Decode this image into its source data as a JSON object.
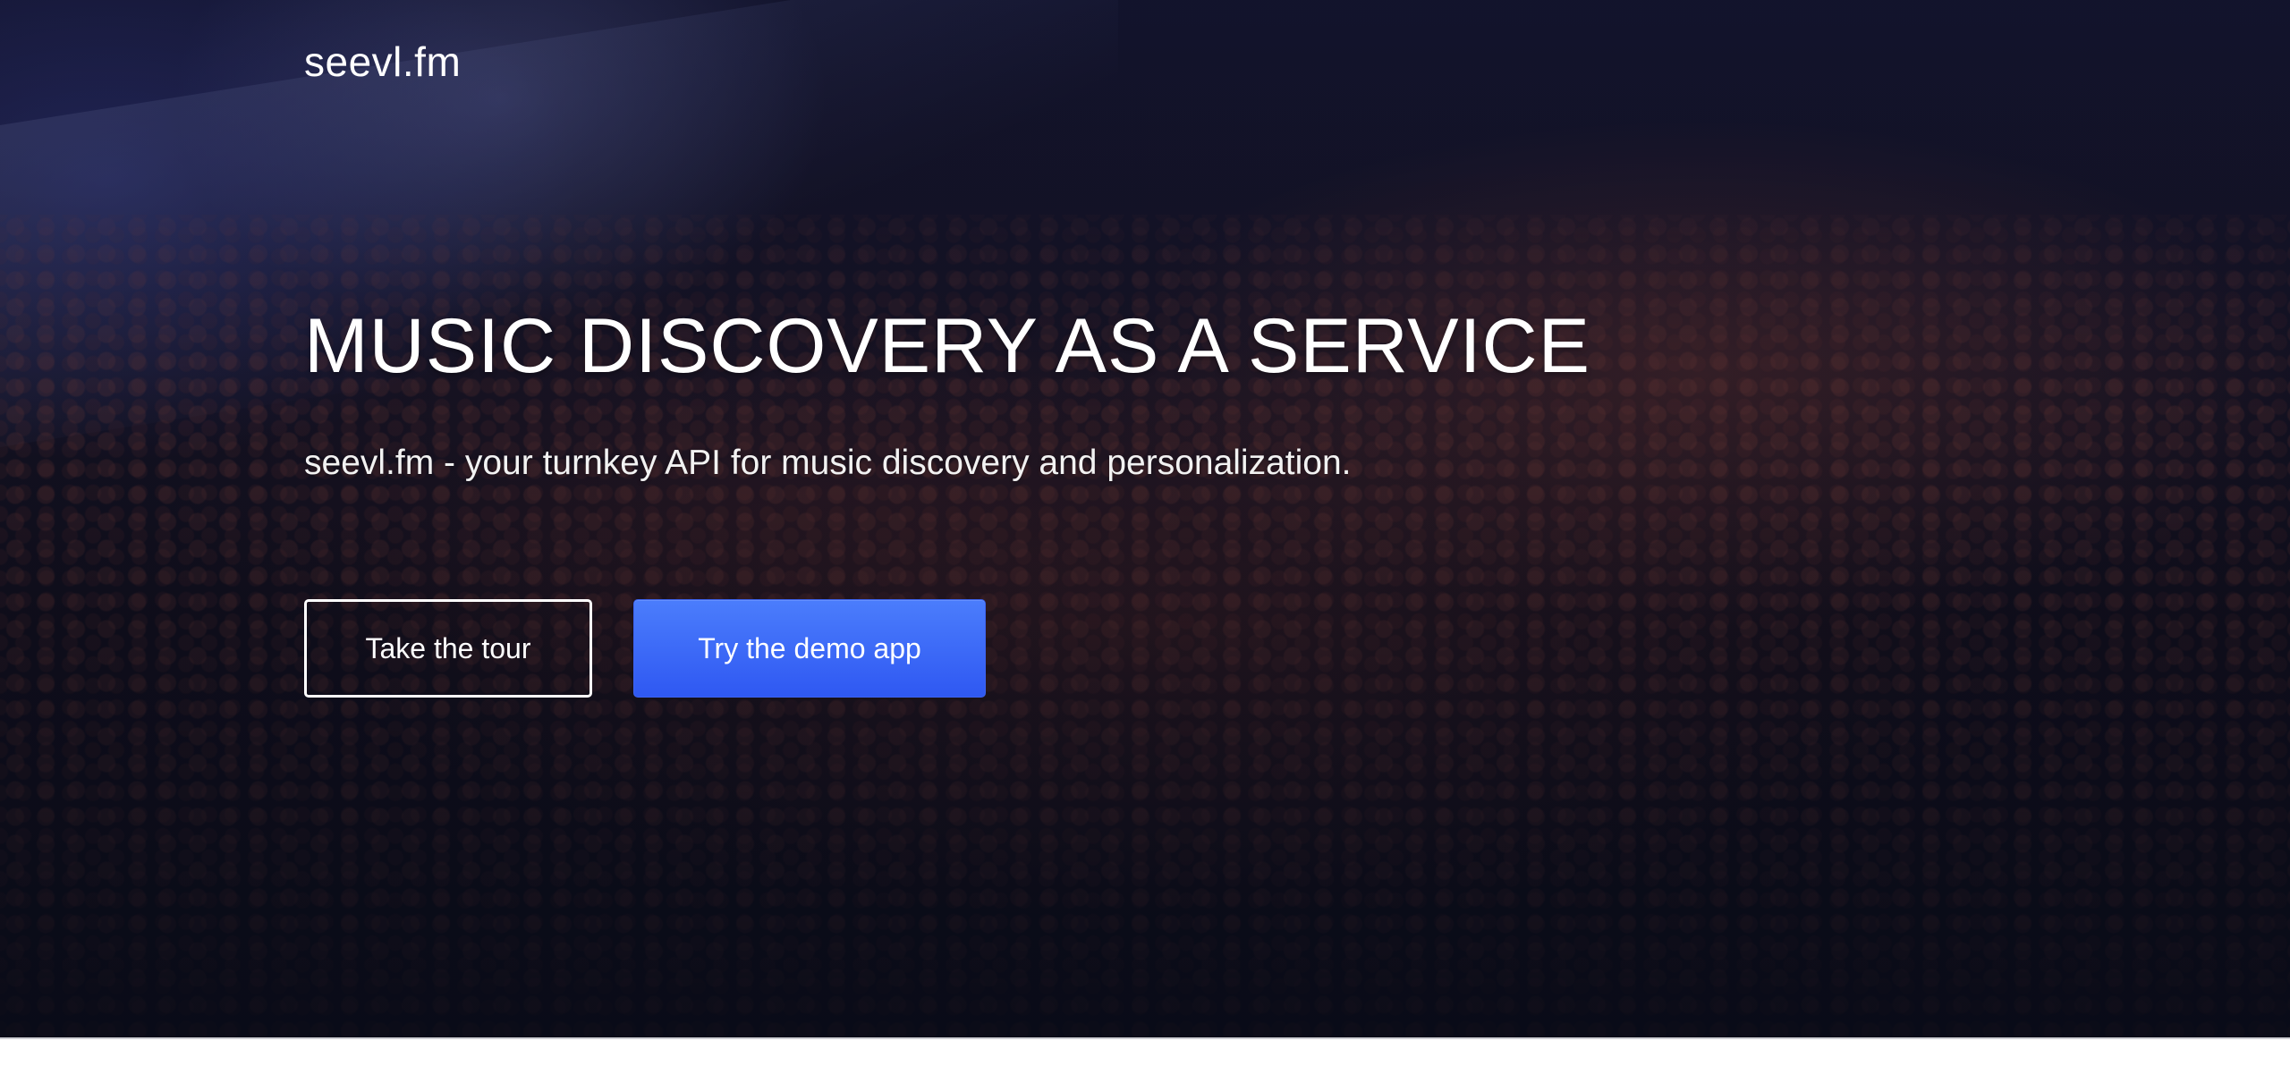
{
  "brand": {
    "name": "seevl.fm"
  },
  "hero": {
    "headline": "MUSIC DISCOVERY AS A SERVICE",
    "subheadline": "seevl.fm - your turnkey API for music discovery and personalization.",
    "buttons": {
      "tour_label": "Take the tour",
      "demo_label": "Try the demo app"
    },
    "background_image": "concert-crowd-image"
  },
  "colors": {
    "primary_button": "#3d68f8",
    "hero_dark": "#0b0d1c",
    "text": "#ffffff"
  }
}
